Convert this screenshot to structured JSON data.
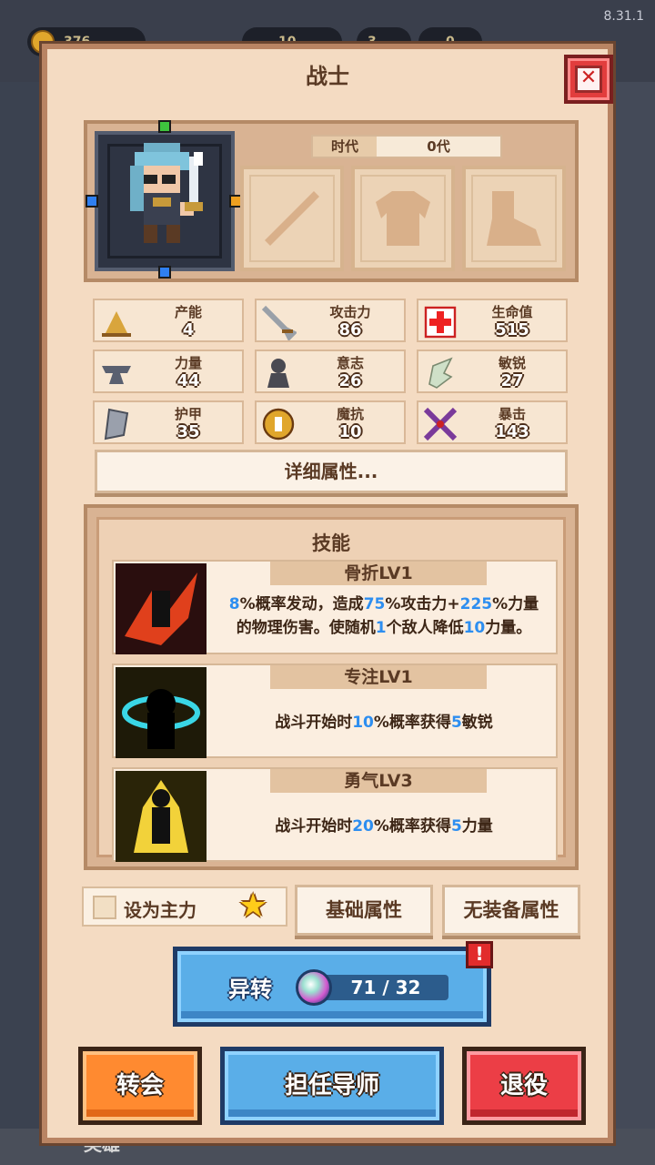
{
  "version": "8.31.1",
  "background": {
    "resources": [
      "376",
      "10",
      "3",
      "0"
    ],
    "hero_tab_label": "英雄"
  },
  "dialog": {
    "title": "战士"
  },
  "era": {
    "label": "时代",
    "value": "0代"
  },
  "stats": [
    {
      "name": "产能",
      "value": "4",
      "icon": "production-icon"
    },
    {
      "name": "攻击力",
      "value": "86",
      "icon": "sword-icon"
    },
    {
      "name": "生命值",
      "value": "515",
      "icon": "health-cross-icon"
    },
    {
      "name": "力量",
      "value": "44",
      "icon": "anvil-icon"
    },
    {
      "name": "意志",
      "value": "26",
      "icon": "will-icon"
    },
    {
      "name": "敏锐",
      "value": "27",
      "icon": "wing-icon"
    },
    {
      "name": "护甲",
      "value": "35",
      "icon": "shield-icon"
    },
    {
      "name": "魔抗",
      "value": "10",
      "icon": "magic-resist-icon"
    },
    {
      "name": "暴击",
      "value": "143",
      "icon": "crossed-swords-icon"
    }
  ],
  "detail_button": "详细属性...",
  "skills": {
    "title": "技能",
    "items": [
      {
        "name": "骨折LV1",
        "desc_parts": [
          [
            "8",
            true
          ],
          [
            "%概率发动，造成",
            false
          ],
          [
            "75",
            true
          ],
          [
            "%攻击力+",
            false
          ],
          [
            "225",
            true
          ],
          [
            "%力量",
            false
          ],
          [
            "\n的物理伤害。使随机",
            false
          ],
          [
            "1",
            true
          ],
          [
            "个敌人降低",
            false
          ],
          [
            "10",
            true
          ],
          [
            "力量。",
            false
          ]
        ]
      },
      {
        "name": "专注LV1",
        "desc_parts": [
          [
            "战斗开始时",
            false
          ],
          [
            "10",
            true
          ],
          [
            "%概率获得",
            false
          ],
          [
            "5",
            true
          ],
          [
            "敏锐",
            false
          ]
        ]
      },
      {
        "name": "勇气LV3",
        "desc_parts": [
          [
            "战斗开始时",
            false
          ],
          [
            "20",
            true
          ],
          [
            "%概率获得",
            false
          ],
          [
            "5",
            true
          ],
          [
            "力量",
            false
          ]
        ]
      }
    ]
  },
  "set_main_label": "设为主力",
  "tabs": {
    "base_attr": "基础属性",
    "no_equip_attr": "无装备属性"
  },
  "transform": {
    "label": "异转",
    "count": "71 / 32",
    "alert": "!"
  },
  "buttons": {
    "reincarnate": "转会",
    "mentor": "担任导师",
    "retire": "退役"
  },
  "colors": {
    "highlight": "#2d8ef0",
    "panel": "#f4dbc2",
    "orange_button": "#ff8a30",
    "blue_button": "#5aaee8",
    "red_button": "#ec3e46"
  }
}
